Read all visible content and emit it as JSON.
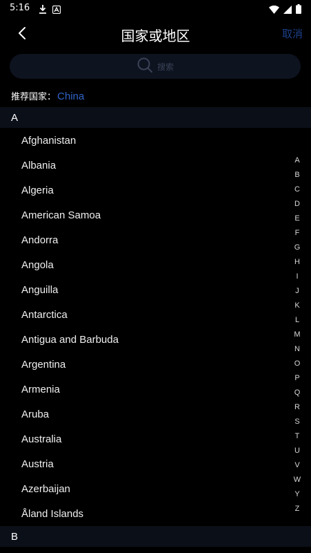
{
  "status_bar": {
    "time": "5:16",
    "left_icons": [
      "download-icon",
      "app-notification-icon"
    ],
    "right_icons": [
      "wifi-icon",
      "signal-icon",
      "battery-icon"
    ]
  },
  "header": {
    "title": "国家或地区",
    "cancel_label": "取消",
    "back_icon": "chevron-left-icon"
  },
  "search": {
    "placeholder": "搜索",
    "icon": "search-icon"
  },
  "recommended": {
    "label": "推荐国家：",
    "country": "China"
  },
  "sections": [
    {
      "letter": "A",
      "countries": [
        "Afghanistan",
        "Albania",
        "Algeria",
        "American Samoa",
        "Andorra",
        "Angola",
        "Anguilla",
        "Antarctica",
        "Antigua and Barbuda",
        "Argentina",
        "Armenia",
        "Aruba",
        "Australia",
        "Austria",
        "Azerbaijan",
        "Åland Islands"
      ]
    },
    {
      "letter": "B",
      "countries": []
    }
  ],
  "index_letters": [
    "A",
    "B",
    "C",
    "D",
    "E",
    "F",
    "G",
    "H",
    "I",
    "J",
    "K",
    "L",
    "M",
    "N",
    "O",
    "P",
    "Q",
    "R",
    "S",
    "T",
    "U",
    "V",
    "W",
    "Y",
    "Z"
  ],
  "colors": {
    "background": "#000000",
    "accent": "#2f63c8",
    "cancel": "#1d3f8a",
    "search_bg": "#0e1320",
    "section_bg": "#0b0f18"
  }
}
